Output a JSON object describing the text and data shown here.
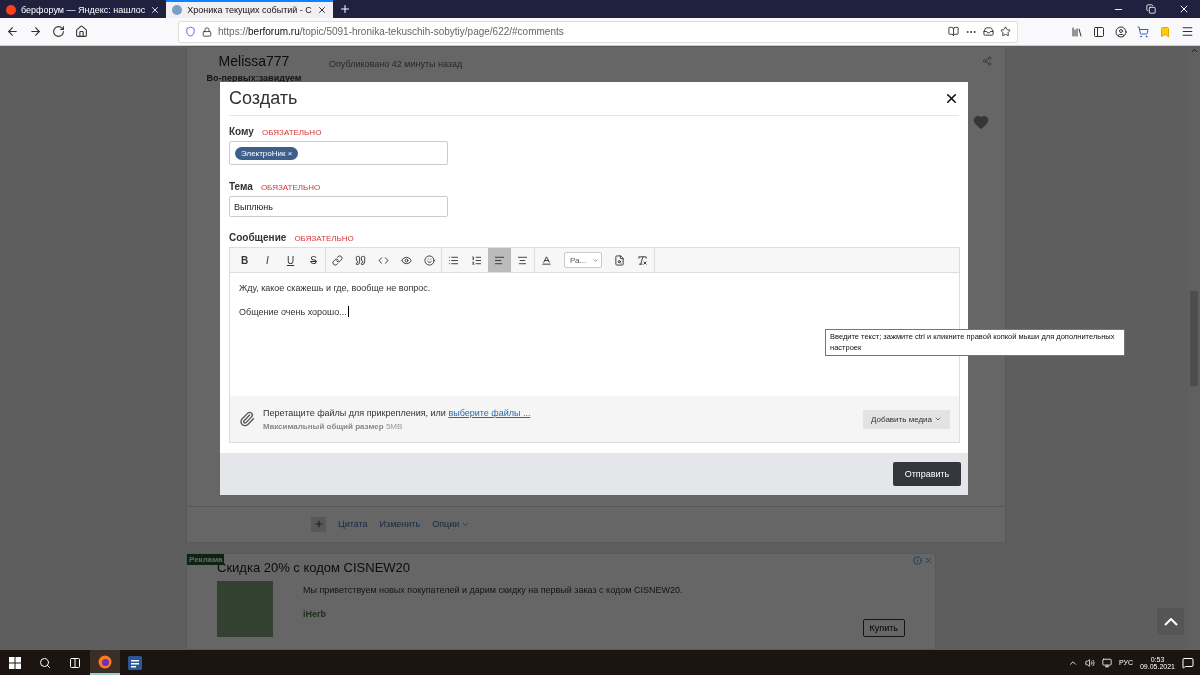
{
  "browser": {
    "tabs": [
      {
        "title": "берфорум — Яндекс: нашлос",
        "selected": false
      },
      {
        "title": "Хроника текущих событий - С",
        "selected": true
      }
    ],
    "url": {
      "scheme": "https://",
      "domain": "berforum.ru",
      "path": "/topic/5091-hronika-tekuschih-sobytiy/page/622/#comments"
    }
  },
  "post": {
    "author": "Melissa777",
    "author_status": "Во-первых:завидуем",
    "published": "Опубликовано 42 минуты назад",
    "actions": [
      "Цитата",
      "Изменить",
      "Опции"
    ]
  },
  "ad": {
    "badge": "Реклама",
    "title": "Скидка 20% с кодом CISNEW20",
    "text": "Мы приветствуем новых покупателей и дарим скидку на первый заказ с кодом CISNEW20.",
    "brand": "iHerb",
    "button": "Купить"
  },
  "dialog": {
    "title": "Создать",
    "fields": [
      {
        "kind": "tags",
        "label": "Кому",
        "required": "ОБЯЗАТЕЛЬНО",
        "tags": [
          {
            "label": "ЭлектроНик",
            "remove": "×"
          }
        ]
      },
      {
        "kind": "text",
        "label": "Тема",
        "required": "ОБЯЗАТЕЛЬНО",
        "value": "Выплюнь"
      },
      {
        "kind": "editor",
        "label": "Сообщение",
        "required": "ОБЯЗАТЕЛЬНО"
      }
    ],
    "toolbar": [
      [
        {
          "kind": "text",
          "label": "B",
          "selected": false
        },
        {
          "kind": "text",
          "label": "I",
          "selected": false
        },
        {
          "kind": "text",
          "label": "U",
          "selected": false
        },
        {
          "kind": "text",
          "label": "S",
          "selected": false
        }
      ],
      [
        {
          "kind": "icon",
          "selected": false
        },
        {
          "kind": "icon",
          "selected": false
        },
        {
          "kind": "icon",
          "selected": false
        },
        {
          "kind": "icon",
          "selected": false
        },
        {
          "kind": "icon",
          "selected": false
        }
      ],
      [
        {
          "kind": "icon",
          "selected": false
        },
        {
          "kind": "icon",
          "selected": false
        },
        {
          "kind": "icon",
          "selected": true
        },
        {
          "kind": "icon",
          "selected": false
        }
      ],
      [
        {
          "kind": "icon",
          "selected": false
        },
        {
          "kind": "dropdown",
          "label": "Ра...",
          "selected": false
        },
        {
          "kind": "icon",
          "selected": false
        },
        {
          "kind": "icon",
          "selected": false
        }
      ]
    ],
    "message": [
      "Жду, какое скажешь и где, вообще не вопрос.",
      "Общение очень хорошо..."
    ],
    "attach": {
      "text": "Перетащите файлы для прикрепления, или ",
      "link": "выберите файлы ...",
      "limit": "**Максимальный общий размер** 5MB",
      "media_button": "Добавить медиа"
    },
    "submit": "Отправить"
  },
  "tooltip": "Введите текст; зажмите ctrl и кликните правой копкой мыши для дополнительных настроек",
  "taskbar": {
    "language": "РУС",
    "time": "0:53",
    "date": "09.05.2021"
  }
}
